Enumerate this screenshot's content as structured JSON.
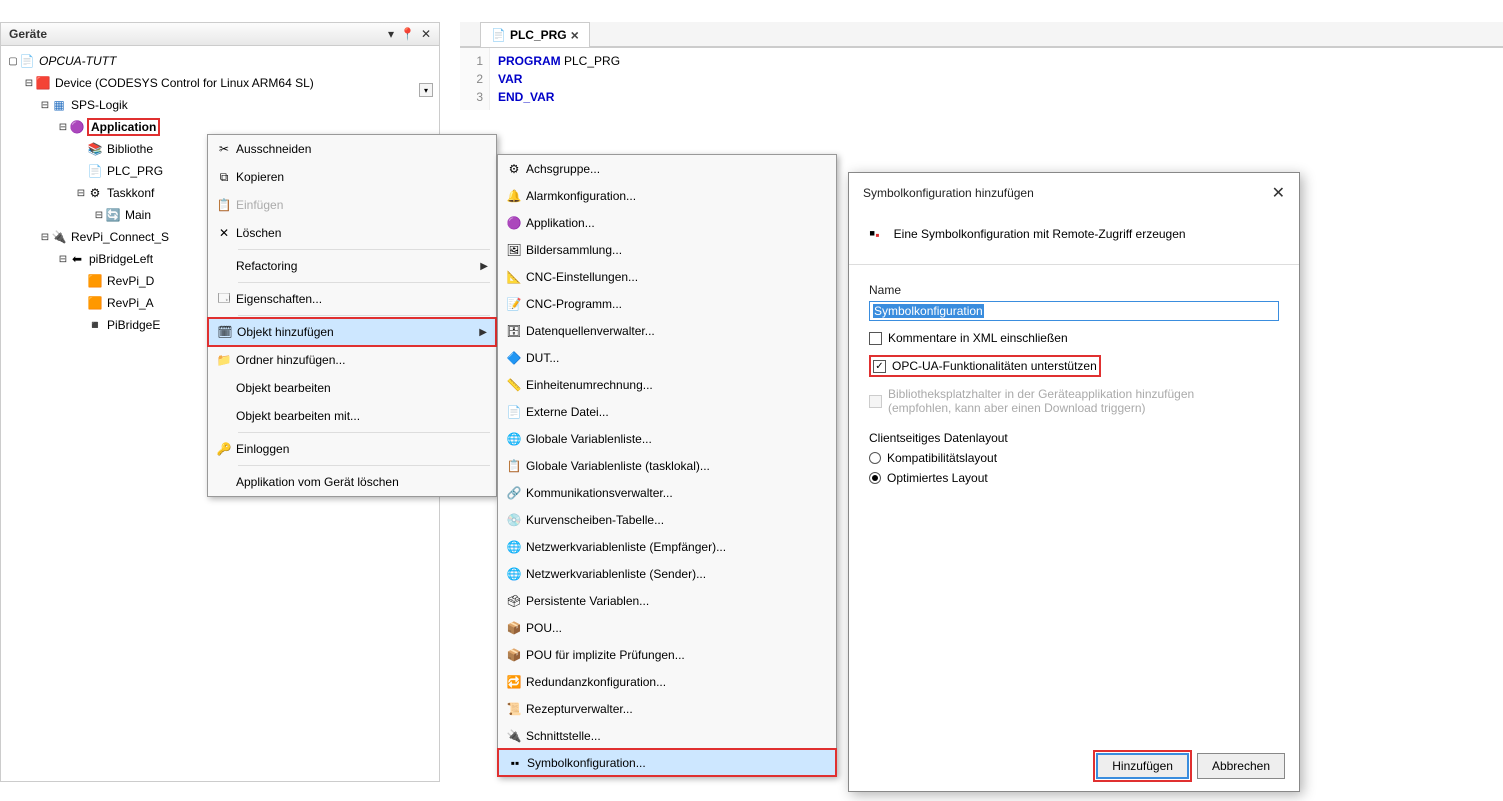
{
  "panel": {
    "title": "Geräte",
    "project": "OPCUA-TUTT",
    "device": "Device (CODESYS Control for Linux ARM64 SL)",
    "sps": "SPS-Logik",
    "application": "Application",
    "lib": "Bibliothe",
    "plc": "PLC_PRG",
    "taskconf": "Taskkonf",
    "main": "Main",
    "revpi_connect": "RevPi_Connect_S",
    "pibridge": "piBridgeLeft",
    "revpi_d": "RevPi_D",
    "revpi_a": "RevPi_A",
    "pibridge_e": "PiBridgeE"
  },
  "tab": {
    "label": "PLC_PRG"
  },
  "code": {
    "l1a": "PROGRAM",
    "l1b": " PLC_PRG",
    "l2": "VAR",
    "l3": "END_VAR"
  },
  "menu1": {
    "cut": "Ausschneiden",
    "copy": "Kopieren",
    "paste": "Einfügen",
    "delete": "Löschen",
    "refactor": "Refactoring",
    "props": "Eigenschaften...",
    "addobj": "Objekt hinzufügen",
    "addfolder": "Ordner hinzufügen...",
    "editobj": "Objekt bearbeiten",
    "editobjwith": "Objekt bearbeiten mit...",
    "login": "Einloggen",
    "delapp": "Applikation vom Gerät löschen"
  },
  "menu2": {
    "items": [
      "Achsgruppe...",
      "Alarmkonfiguration...",
      "Applikation...",
      "Bildersammlung...",
      "CNC-Einstellungen...",
      "CNC-Programm...",
      "Datenquellenverwalter...",
      "DUT...",
      "Einheitenumrechnung...",
      "Externe Datei...",
      "Globale Variablenliste...",
      "Globale Variablenliste (tasklokal)...",
      "Kommunikationsverwalter...",
      "Kurvenscheiben-Tabelle...",
      "Netzwerkvariablenliste (Empfänger)...",
      "Netzwerkvariablenliste (Sender)...",
      "Persistente Variablen...",
      "POU...",
      "POU für implizite Prüfungen...",
      "Redundanzkonfiguration...",
      "Rezepturverwalter...",
      "Schnittstelle...",
      "Symbolkonfiguration..."
    ]
  },
  "dialog": {
    "title": "Symbolkonfiguration hinzufügen",
    "intro": "Eine Symbolkonfiguration mit Remote-Zugriff erzeugen",
    "name_label": "Name",
    "name_value": "Symbolkonfiguration",
    "chk_xml": "Kommentare in XML einschließen",
    "chk_opcua": "OPC-UA-Funktionalitäten unterstützen",
    "chk_lib": "Bibliotheksplatzhalter in der Geräteapplikation hinzufügen (empfohlen, kann aber einen Download triggern)",
    "layout_group": "Clientseitiges Datenlayout",
    "radio_compat": "Kompatibilitätslayout",
    "radio_opt": "Optimiertes Layout",
    "btn_add": "Hinzufügen",
    "btn_cancel": "Abbrechen"
  }
}
